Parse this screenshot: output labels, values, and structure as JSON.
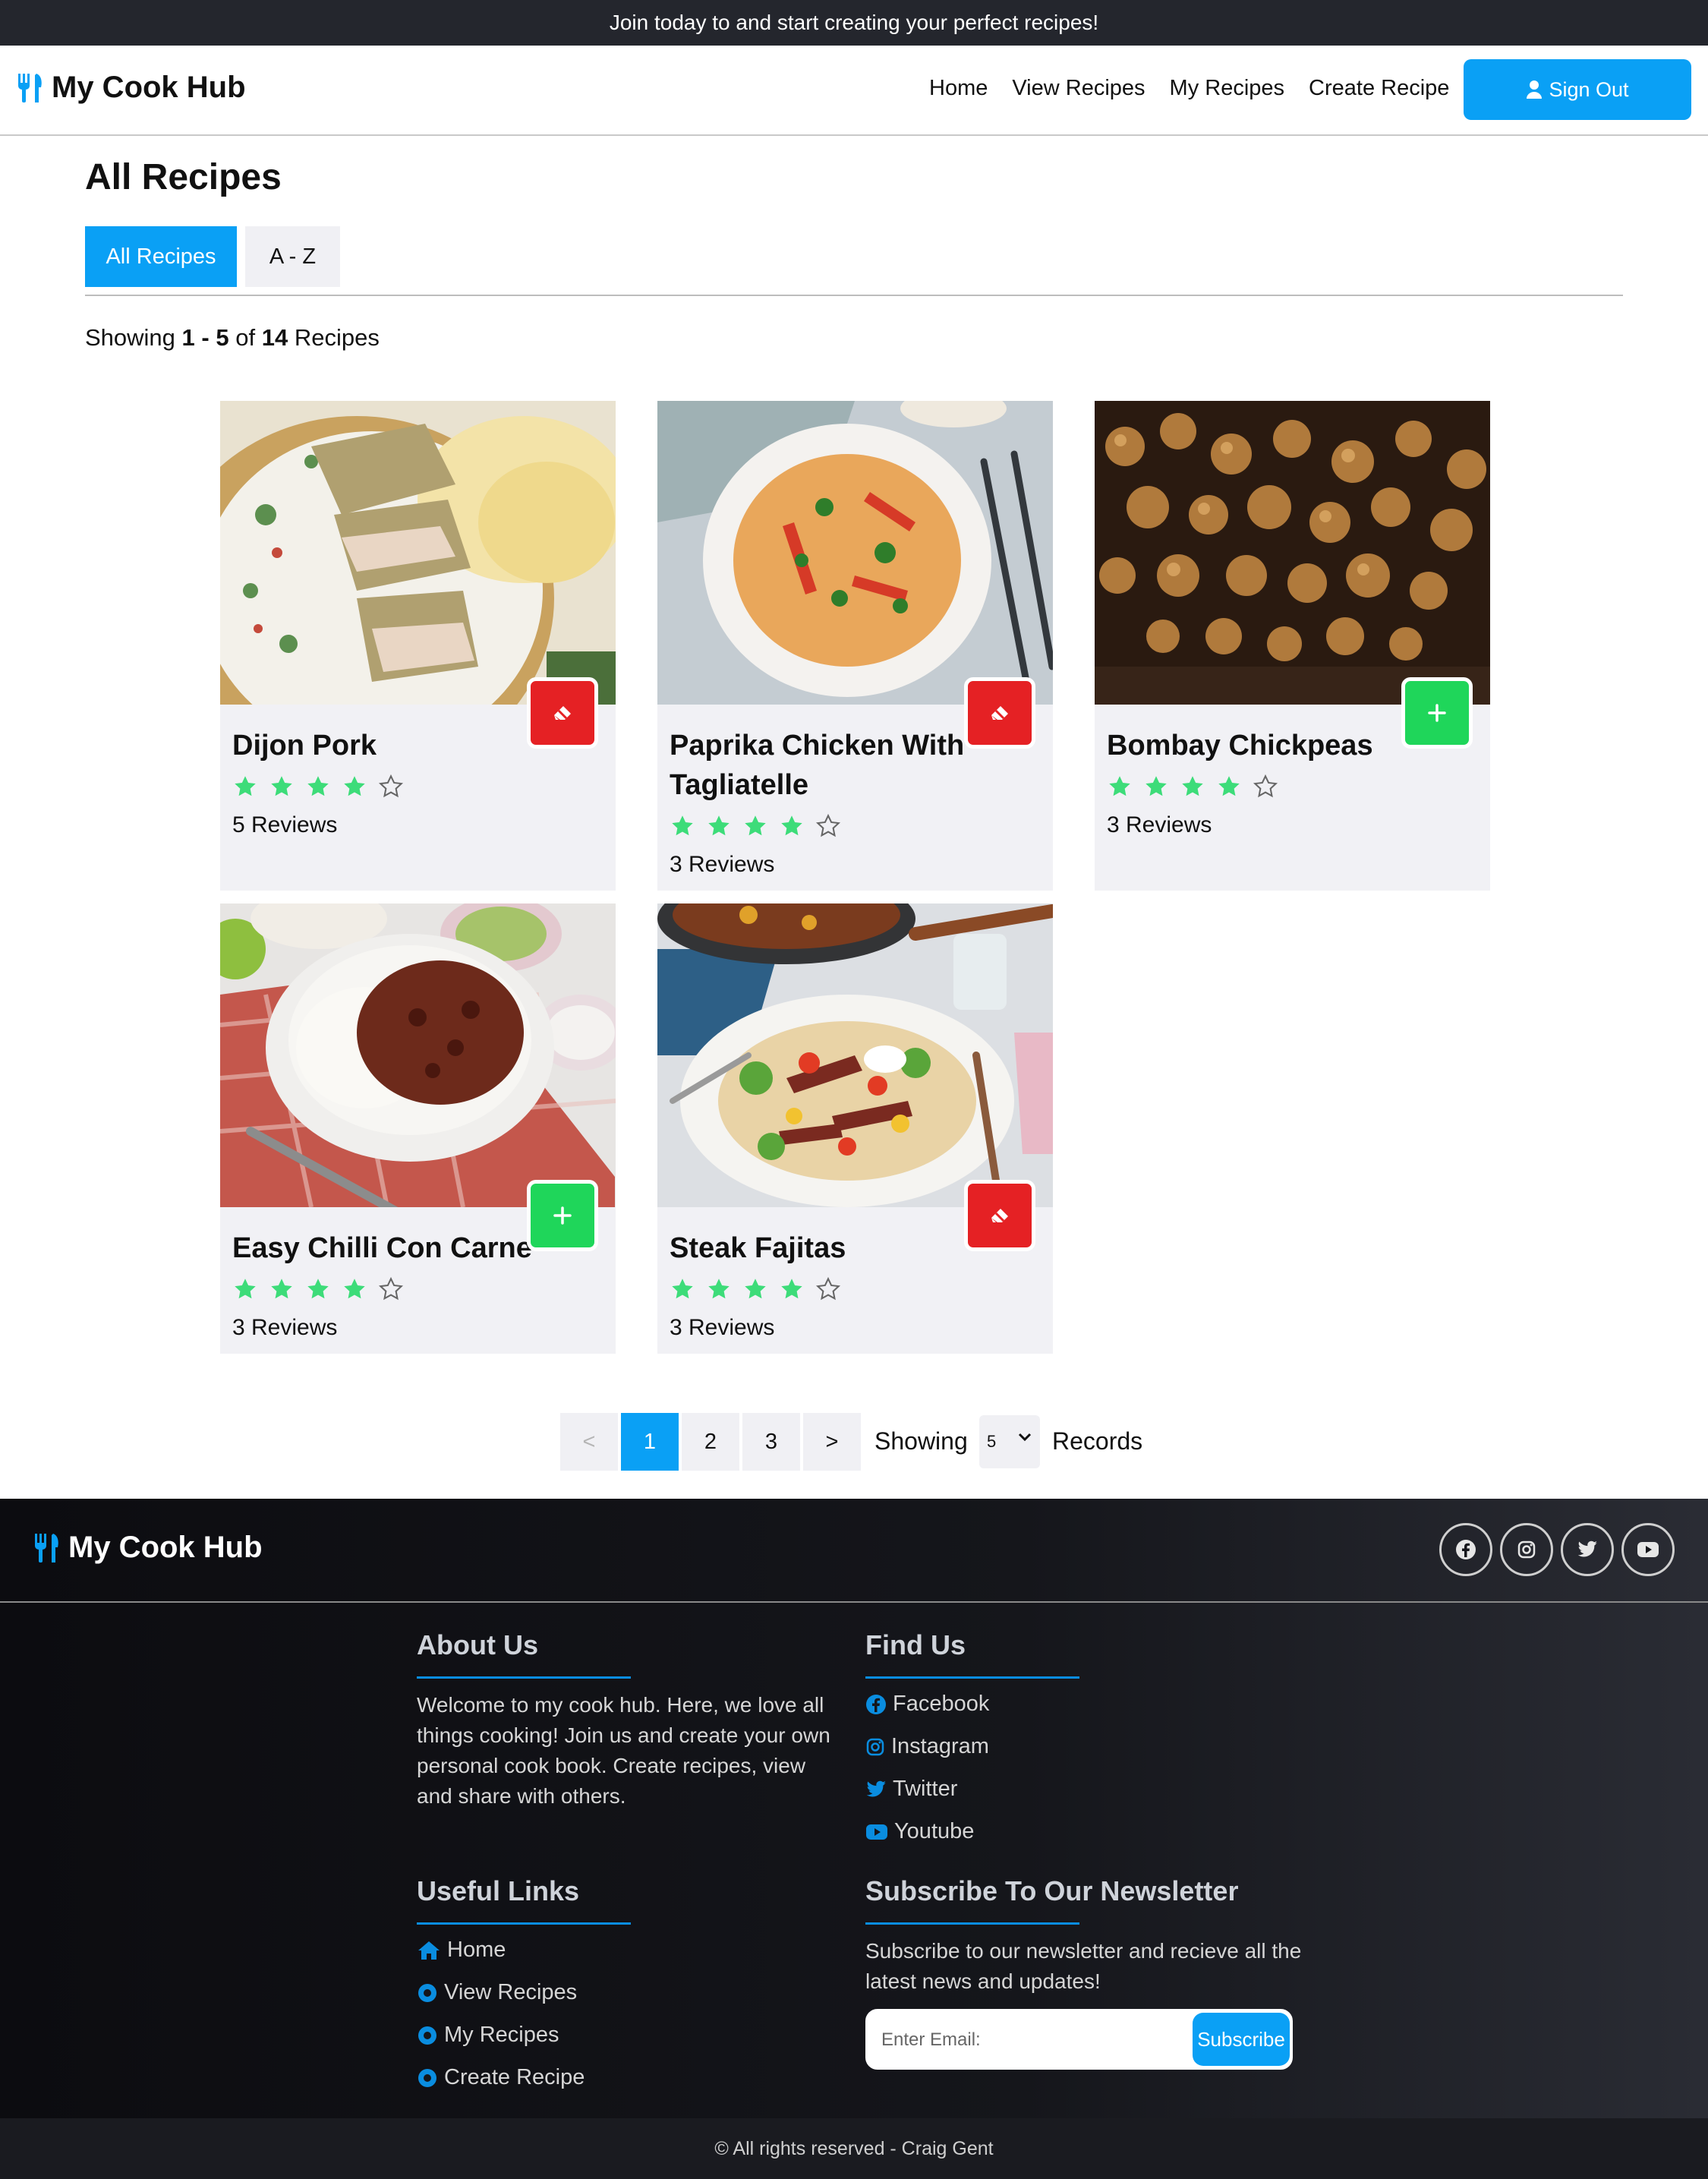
{
  "announcement": "Join today to and start creating your perfect recipes!",
  "brand": {
    "name": "My Cook Hub",
    "icon": "utensils-icon",
    "accent": "#0aa0f5"
  },
  "nav": {
    "links": [
      "Home",
      "View Recipes",
      "My Recipes",
      "Create Recipe"
    ],
    "signout_label": "Sign Out",
    "signout_icon": "user-icon"
  },
  "page": {
    "title": "All Recipes",
    "tabs": [
      "All Recipes",
      "A - Z"
    ],
    "active_tab": "All Recipes",
    "showing": {
      "prefix": "Showing",
      "from": "1",
      "dash": "-",
      "to": "5",
      "of": "of",
      "total": "14",
      "suffix": "Recipes"
    }
  },
  "recipes": [
    {
      "title": "Dijon Pork",
      "rating": 4,
      "max_rating": 5,
      "reviews": "5 Reviews",
      "action": "remove",
      "action_icon": "eraser-icon"
    },
    {
      "title": "Paprika Chicken With Tagliatelle",
      "rating": 4,
      "max_rating": 5,
      "reviews": "3 Reviews",
      "action": "remove",
      "action_icon": "eraser-icon"
    },
    {
      "title": "Bombay Chickpeas",
      "rating": 4,
      "max_rating": 5,
      "reviews": "3 Reviews",
      "action": "add",
      "action_icon": "plus-icon"
    },
    {
      "title": "Easy Chilli Con Carne",
      "rating": 4,
      "max_rating": 5,
      "reviews": "3 Reviews",
      "action": "add",
      "action_icon": "plus-icon"
    },
    {
      "title": "Steak Fajitas",
      "rating": 4,
      "max_rating": 5,
      "reviews": "3 Reviews",
      "action": "remove",
      "action_icon": "eraser-icon"
    }
  ],
  "pagination": {
    "prev": "<",
    "pages": [
      "1",
      "2",
      "3"
    ],
    "current": "1",
    "next": ">",
    "showing_label": "Showing",
    "per_page": "5",
    "records_label": "Records"
  },
  "footer": {
    "brand": "My Cook Hub",
    "social_icons": [
      "facebook-icon",
      "instagram-icon",
      "twitter-icon",
      "youtube-icon"
    ],
    "about": {
      "heading": "About Us",
      "text": "Welcome to my cook hub. Here, we love all things cooking! Join us and create your own personal cook book. Create recipes, view and share with others."
    },
    "find_us": {
      "heading": "Find Us",
      "links": [
        "Facebook",
        "Instagram",
        "Twitter",
        "Youtube"
      ]
    },
    "useful_links": {
      "heading": "Useful Links",
      "links": [
        "Home",
        "View Recipes",
        "My Recipes",
        "Create Recipe"
      ]
    },
    "newsletter": {
      "heading": "Subscribe To Our Newsletter",
      "text": "Subscribe to our newsletter and recieve all the latest news and updates!",
      "placeholder": "Enter Email:",
      "button": "Subscribe"
    },
    "copyright": "© All rights reserved - Craig Gent"
  },
  "colors": {
    "star": "#3ddc79",
    "remove": "#e52124",
    "add": "#1fd65a",
    "link_accent": "#0a8de0"
  }
}
